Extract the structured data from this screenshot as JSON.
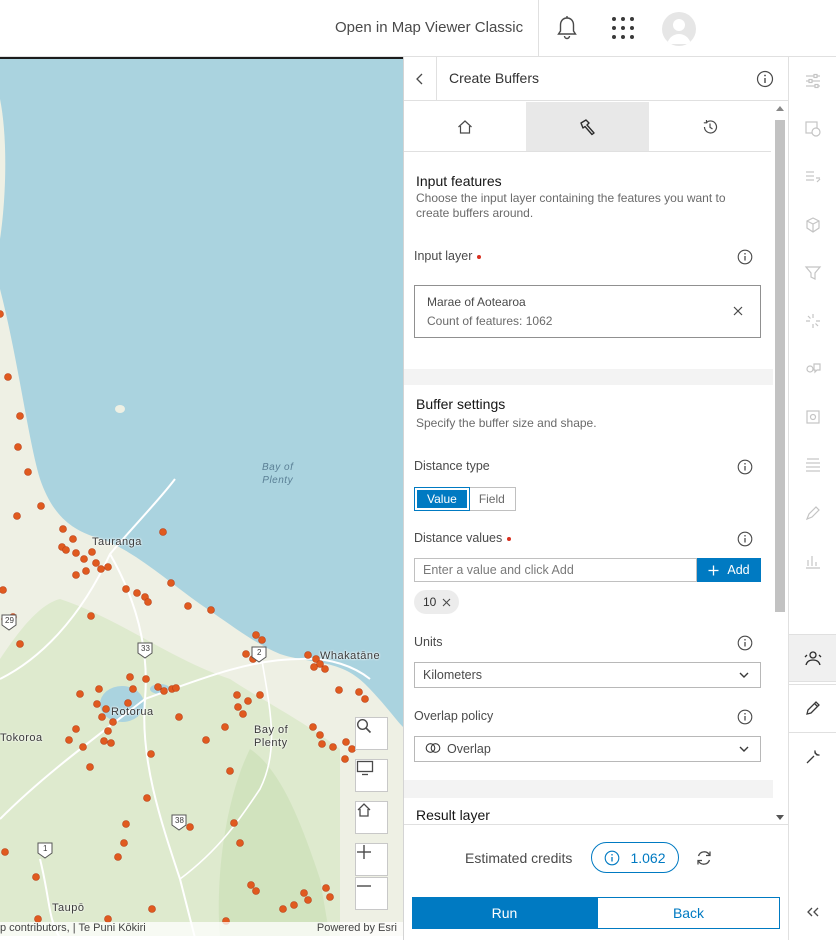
{
  "header": {
    "open_classic": "Open in Map Viewer Classic",
    "bell_icon": "bell-icon",
    "apps_icon": "apps-grid-icon",
    "avatar_icon": "user-avatar"
  },
  "map": {
    "labels": {
      "bay_of_plenty_water": "Bay of\nPlenty",
      "tauranga": "Tauranga",
      "whakatane": "Whakatāne",
      "rotorua": "Rotorua",
      "bay_of_plenty_region": "Bay of\nPlenty",
      "tokoroa": "Tokoroa",
      "taupo": "Taupō",
      "route_29": "29",
      "route_33": "33",
      "route_2": "2",
      "route_38": "38",
      "route_1": "1"
    },
    "attribution_left": "p contributors, | Te Puni Kōkiri",
    "attribution_right": "Powered by Esri",
    "buttons": [
      "search-icon",
      "screen-icon",
      "home-icon",
      "zoom-in-icon",
      "zoom-out-icon"
    ]
  },
  "panel": {
    "title": "Create Buffers",
    "tabs": [
      "home-icon",
      "tool-hammer-icon",
      "history-icon"
    ],
    "input_section": {
      "title": "Input features",
      "description": "Choose the input layer containing the features you want to create buffers around.",
      "input_layer_label": "Input layer",
      "layer_name": "Marae of Aotearoa",
      "layer_count": "Count of features: 1062"
    },
    "buffer_section": {
      "title": "Buffer settings",
      "description": "Specify the buffer size and shape.",
      "distance_type_label": "Distance type",
      "distance_type_options": [
        "Value",
        "Field"
      ],
      "distance_values_label": "Distance values",
      "distance_placeholder": "Enter a value and click Add",
      "add_label": "Add",
      "chip_value": "10",
      "units_label": "Units",
      "units_value": "Kilometers",
      "overlap_label": "Overlap policy",
      "overlap_value": "Overlap"
    },
    "result_section": {
      "title": "Result layer"
    },
    "credits": {
      "label": "Estimated credits",
      "value": "1.062"
    },
    "run_label": "Run",
    "back_label": "Back"
  },
  "rail": {
    "items": [
      "properties-icon",
      "styles-icon",
      "fields-icon",
      "layer-3d-icon",
      "filter-icon",
      "effects-icon",
      "configure-pop-ups-icon",
      "labels-icon",
      "attribute-table-icon",
      "sketch-icon",
      "charts-icon",
      "analysis-icon",
      "edit-icon",
      "tools-wrench-icon"
    ],
    "collapse_icon": "collapse-chevrons-icon"
  },
  "colors": {
    "accent": "#007ac2",
    "marker": "#e05a1f",
    "water": "#aad3df",
    "land": "#eef0e4"
  }
}
